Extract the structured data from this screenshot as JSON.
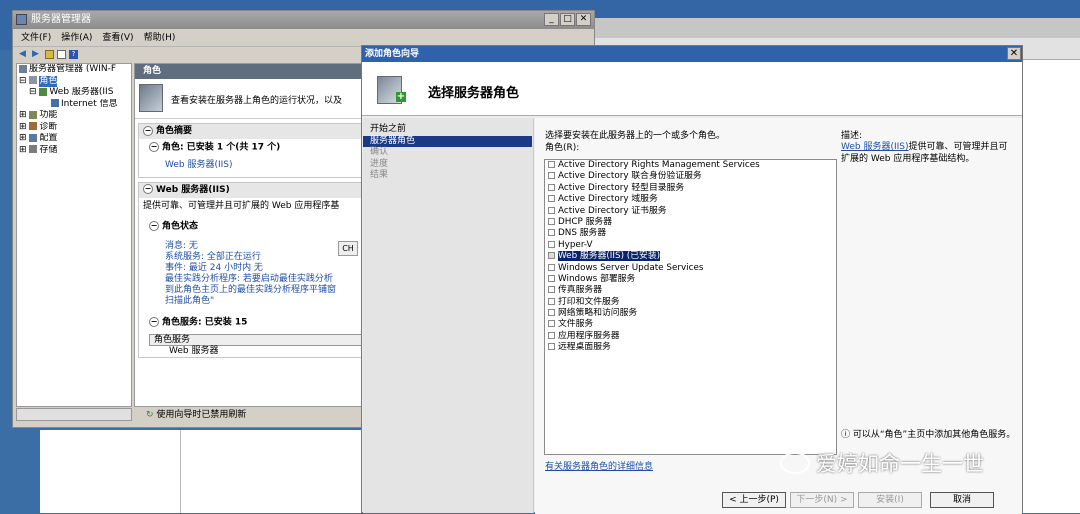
{
  "server_manager": {
    "title": "服务器管理器",
    "menu": [
      "文件(F)",
      "操作(A)",
      "查看(V)",
      "帮助(H)"
    ],
    "tree": [
      {
        "label": "服务器管理器 (WIN-F",
        "selected": false,
        "icon": "server-icon"
      },
      {
        "label": "角色",
        "selected": true,
        "icon": "roles-icon"
      },
      {
        "label": "Web 服务器(IIS",
        "selected": false,
        "icon": "web-server-icon"
      },
      {
        "label": "Internet 信息",
        "selected": false,
        "icon": "iis-icon"
      },
      {
        "label": "功能",
        "selected": false,
        "icon": "features-icon"
      },
      {
        "label": "诊断",
        "selected": false,
        "icon": "diagnostics-icon"
      },
      {
        "label": "配置",
        "selected": false,
        "icon": "configuration-icon"
      },
      {
        "label": "存储",
        "selected": false,
        "icon": "storage-icon"
      }
    ],
    "pane_title": "角色",
    "intro": "查看安装在服务器上角色的运行状况，以及",
    "role_summary": {
      "header": "角色摘要",
      "roles_line": "角色: 已安装 1 个(共 17 个)",
      "role_link": "Web 服务器(IIS)"
    },
    "web_server": {
      "header": "Web 服务器(IIS)",
      "description": "提供可靠、可管理并且可扩展的 Web 应用程序基",
      "role_status": "角色状态",
      "lines": [
        "消息: 无",
        "系统服务: 全部正在运行",
        "事件: 最近 24 小时内 无",
        "最佳实践分析程序: 若要启动最佳实践分析",
        "到此角色主页上的最佳实践分析程序平铺窗",
        "扫描此角色\""
      ],
      "role_services": "角色服务: 已安装 15",
      "table_header": "角色服务",
      "table_row": "Web 服务器",
      "ch_label": "CH"
    },
    "status": "使用向导时已禁用刷新"
  },
  "wizard": {
    "title": "添加角色向导",
    "header": "选择服务器角色",
    "steps": [
      {
        "label": "开始之前",
        "state": "done"
      },
      {
        "label": "服务器角色",
        "state": "current"
      },
      {
        "label": "确认",
        "state": "disabled"
      },
      {
        "label": "进度",
        "state": "disabled"
      },
      {
        "label": "结果",
        "state": "disabled"
      }
    ],
    "instruction": "选择要安装在此服务器上的一个或多个角色。",
    "roles_label": "角色(R):",
    "roles": [
      {
        "label": "Active Directory Rights Management Services",
        "checked": false
      },
      {
        "label": "Active Directory 联合身份验证服务",
        "checked": false
      },
      {
        "label": "Active Directory 轻型目录服务",
        "checked": false
      },
      {
        "label": "Active Directory 域服务",
        "checked": false
      },
      {
        "label": "Active Directory 证书服务",
        "checked": false
      },
      {
        "label": "DHCP 服务器",
        "checked": false
      },
      {
        "label": "DNS 服务器",
        "checked": false
      },
      {
        "label": "Hyper-V",
        "checked": false
      },
      {
        "label": "Web 服务器(IIS)  (已安装)",
        "checked": true,
        "highlighted": true
      },
      {
        "label": "Windows Server Update Services",
        "checked": false
      },
      {
        "label": "Windows 部署服务",
        "checked": false
      },
      {
        "label": "传真服务器",
        "checked": false
      },
      {
        "label": "打印和文件服务",
        "checked": false
      },
      {
        "label": "网络策略和访问服务",
        "checked": false
      },
      {
        "label": "文件服务",
        "checked": false
      },
      {
        "label": "应用程序服务器",
        "checked": false
      },
      {
        "label": "远程桌面服务",
        "checked": false
      }
    ],
    "description_label": "描述:",
    "description_link": "Web 服务器(IIS)",
    "description_text": "提供可靠、可管理并且可扩展的 Web 应用程序基础结构。",
    "hint": "可以从“角色”主页中添加其他角色服务。",
    "more_info_link": "有关服务器角色的详细信息",
    "buttons": {
      "back": "< 上一步(P)",
      "next": "下一步(N) >",
      "install": "安装(I)",
      "cancel": "取消"
    }
  },
  "watermark": "爱婷如命一生一世"
}
